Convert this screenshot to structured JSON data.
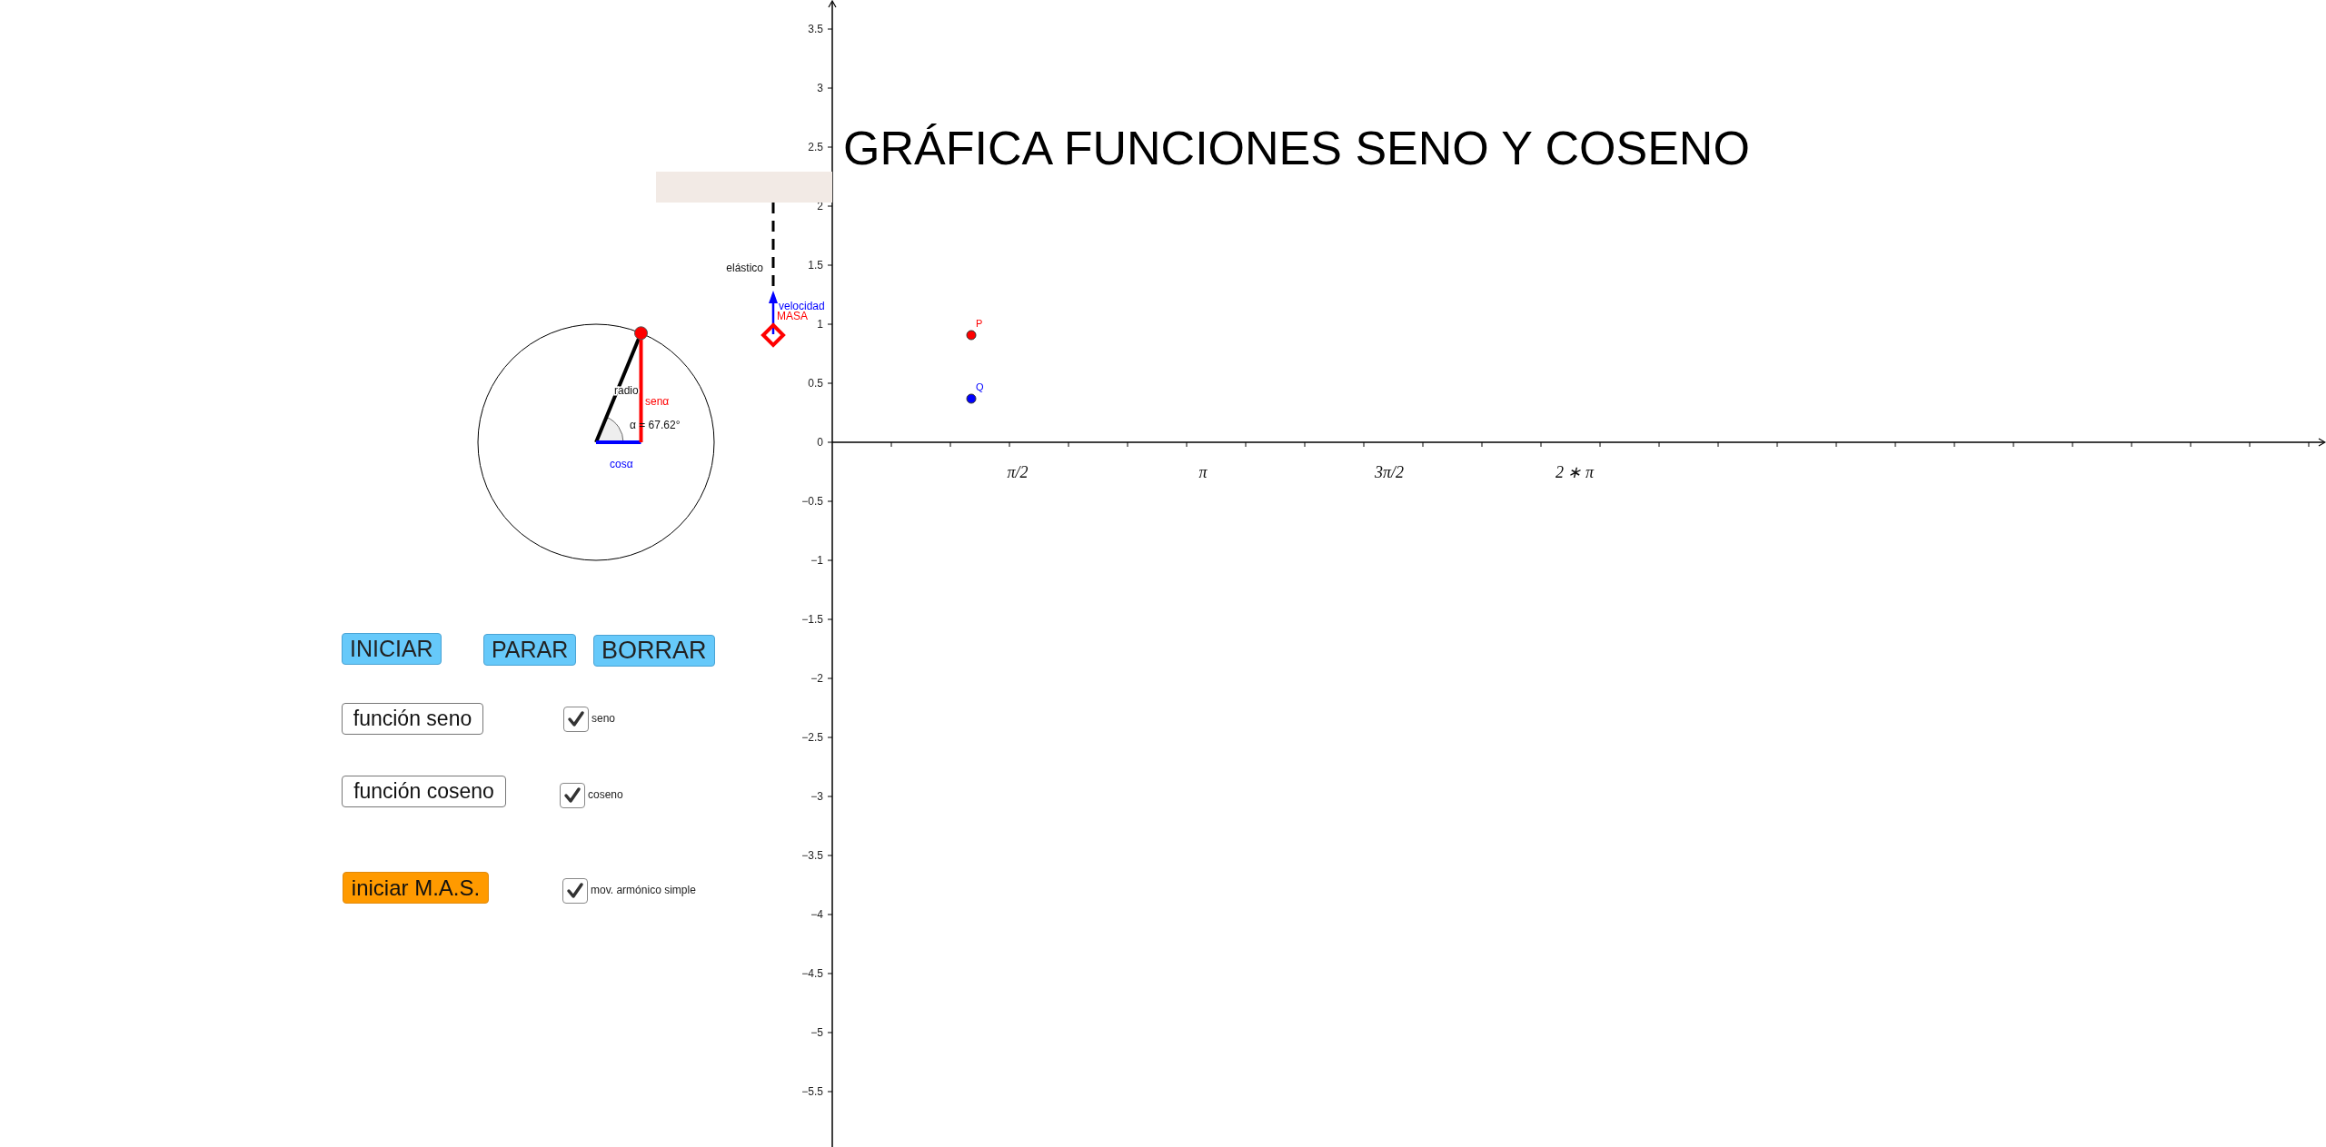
{
  "title": "GRÁFICA FUNCIONES SENO Y COSENO",
  "graph": {
    "y_tick_labels": [
      "3.5",
      "3",
      "2.5",
      "2",
      "1.5",
      "1",
      "0.5",
      "0",
      "−0.5",
      "−1",
      "−1.5",
      "−2",
      "−2.5",
      "−3",
      "−3.5",
      "−4",
      "−4.5",
      "−5",
      "−5.5"
    ],
    "x_tick_labels": [
      "π/2",
      "π",
      "3π/2",
      "2 ∗ π"
    ],
    "points": [
      {
        "label": "P",
        "color": "#ff0000"
      },
      {
        "label": "Q",
        "color": "#0000ff"
      }
    ]
  },
  "unit_circle": {
    "radius_label": "radio",
    "sine_label": "senα",
    "cosine_label": "cosα",
    "angle_label": "α = 67.62°"
  },
  "spring": {
    "label": "elástico",
    "mass_label": "MASA",
    "velocity_label": "velocidad"
  },
  "buttons": [
    {
      "label": "INICIAR",
      "kind": "primary"
    },
    {
      "label": "PARAR",
      "kind": "primary"
    },
    {
      "label": "BORRAR",
      "kind": "primary"
    },
    {
      "label": "función seno",
      "kind": "outline"
    },
    {
      "label": "función coseno",
      "kind": "outline"
    },
    {
      "label": "iniciar M.A.S.",
      "kind": "accent"
    }
  ],
  "checkboxes": [
    {
      "label": "seno",
      "checked": true
    },
    {
      "label": "coseno",
      "checked": true
    },
    {
      "label": "mov. armónico simple",
      "checked": true
    }
  ]
}
